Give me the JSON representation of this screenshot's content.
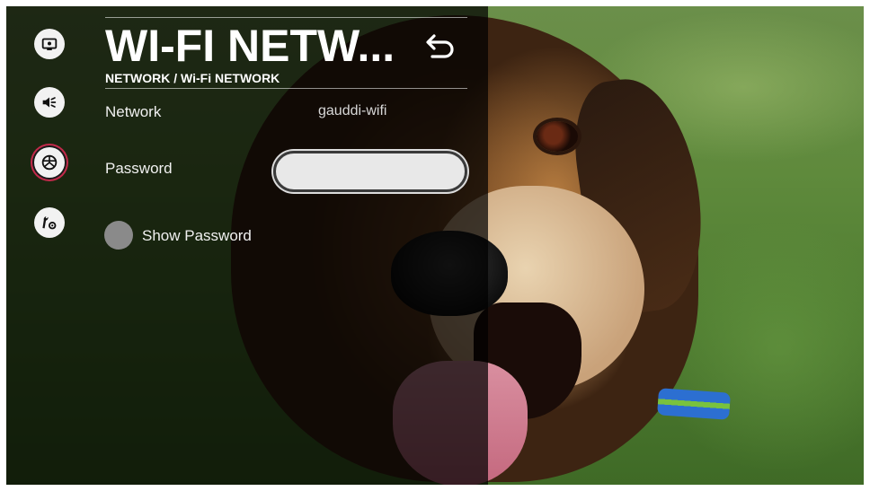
{
  "header": {
    "title": "WI-FI NETW...",
    "breadcrumb": "NETWORK / Wi-Fi NETWORK"
  },
  "nav": {
    "items": [
      {
        "icon": "picture-icon"
      },
      {
        "icon": "sound-icon"
      },
      {
        "icon": "network-icon",
        "active": true
      },
      {
        "icon": "tools-icon"
      }
    ]
  },
  "form": {
    "network_label": "Network",
    "network_value": "gauddi-wifi",
    "password_label": "Password",
    "password_value": "",
    "show_password_label": "Show Password"
  },
  "colors": {
    "accent": "#c22a4a",
    "overlay": "#000000"
  }
}
